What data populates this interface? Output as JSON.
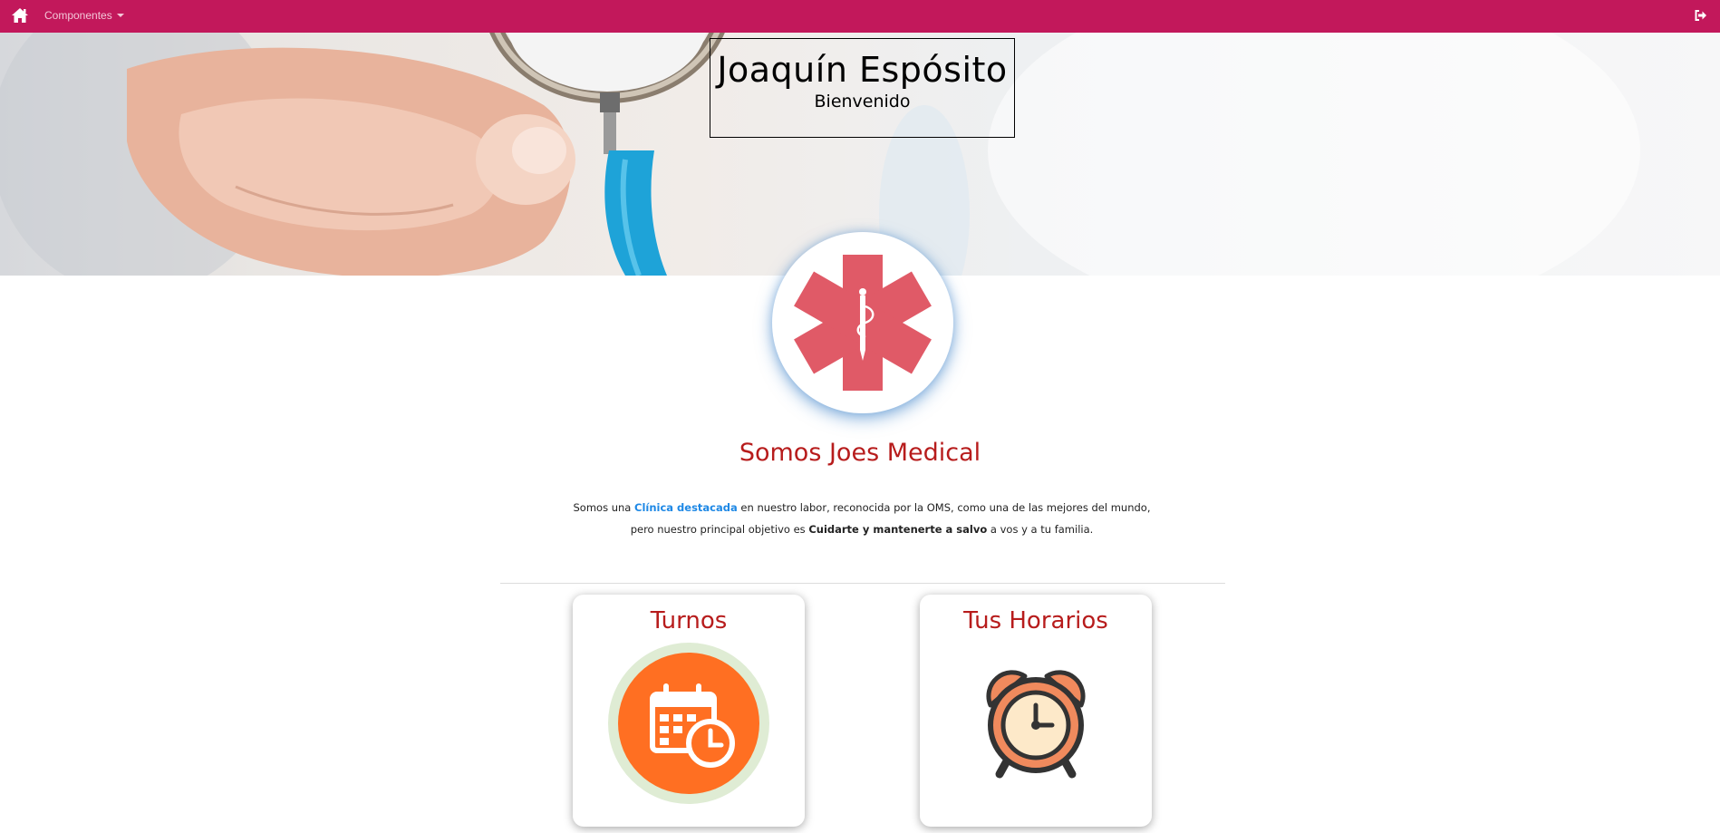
{
  "navbar": {
    "home_icon": "home-icon",
    "menu_label": "Componentes",
    "logout_icon": "sign-out-icon",
    "bg_color": "#c2185b"
  },
  "hero": {
    "name": "Joaquín Espósito",
    "subtitle": "Bienvenido"
  },
  "badge": {
    "icon": "star-of-life-icon",
    "color": "#e05a67"
  },
  "about": {
    "title": "Somos Joes Medical",
    "text_1": "Somos una ",
    "link_text": "Clínica destacada",
    "text_2": " en nuestro labor, reconocida por la OMS, como una de las mejores del mundo, pero nuestro principal objetivo es ",
    "bold_text": "Cuidarte y mantenerte a salvo",
    "text_3": " a vos y a tu familia."
  },
  "cards": [
    {
      "title": "Turnos",
      "icon": "calendar-clock-icon",
      "color": "#ff6f22"
    },
    {
      "title": "Tus Horarios",
      "icon": "alarm-clock-icon",
      "color": "#f08a5d"
    }
  ]
}
